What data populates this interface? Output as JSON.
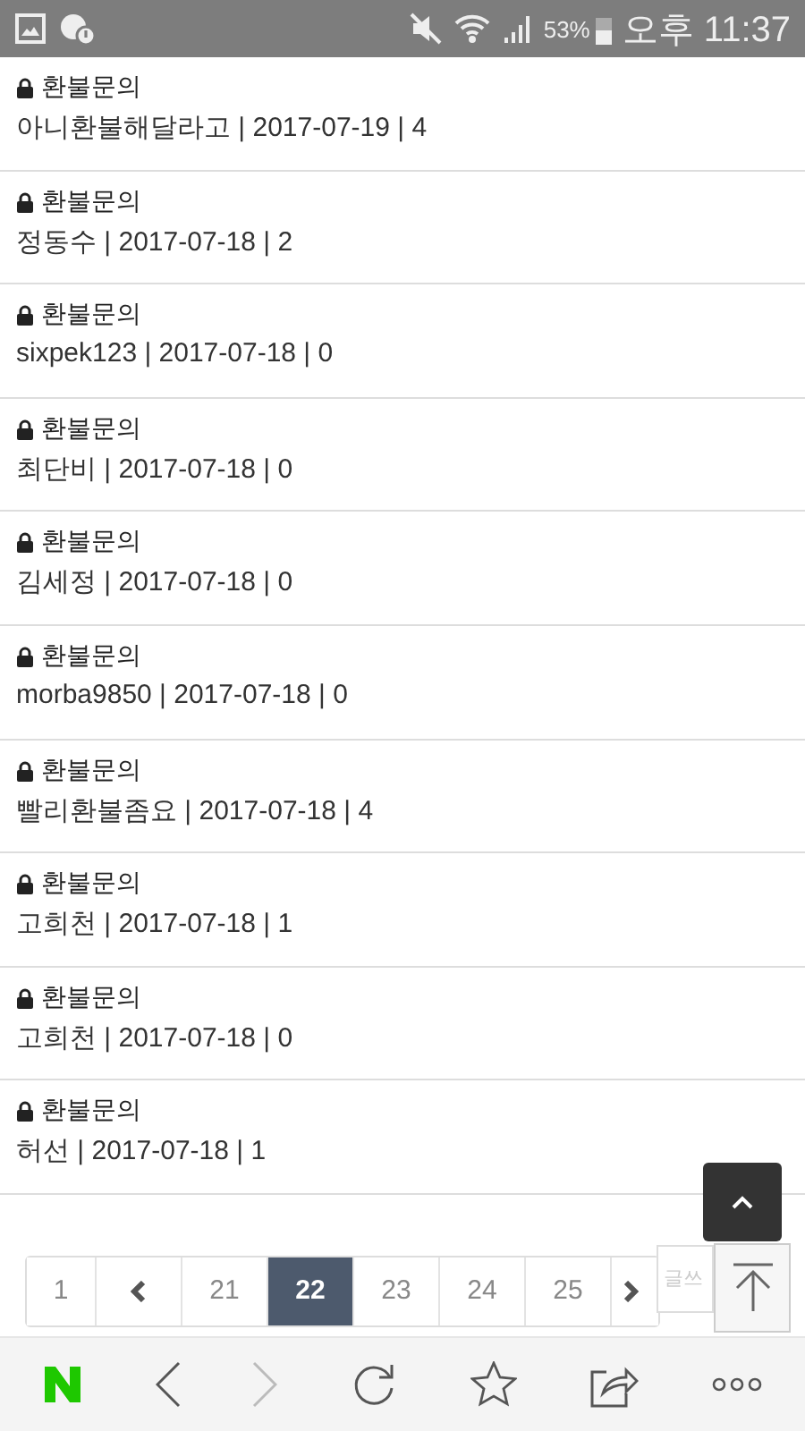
{
  "status_bar": {
    "battery": "53%",
    "time": "오후 11:37"
  },
  "posts": [
    {
      "title": "환불문의",
      "locked": true,
      "meta": "아니환불해달라고 | 2017-07-19 | 4"
    },
    {
      "title": "환불문의",
      "locked": true,
      "meta": "정동수 | 2017-07-18 | 2"
    },
    {
      "title": "환불문의",
      "locked": true,
      "meta": "sixpek123 | 2017-07-18 | 0"
    },
    {
      "title": "환불문의",
      "locked": true,
      "meta": "최단비 | 2017-07-18 | 0"
    },
    {
      "title": "환불문의",
      "locked": true,
      "meta": "김세정 | 2017-07-18 | 0"
    },
    {
      "title": "환불문의",
      "locked": true,
      "meta": "morba9850 | 2017-07-18 | 0"
    },
    {
      "title": "환불문의",
      "locked": true,
      "meta": "빨리환불좀요 | 2017-07-18 | 4"
    },
    {
      "title": "환불문의",
      "locked": true,
      "meta": "고희천 | 2017-07-18 | 1"
    },
    {
      "title": "환불문의",
      "locked": true,
      "meta": "고희천 | 2017-07-18 | 0"
    },
    {
      "title": "환불문의",
      "locked": true,
      "meta": "허선 | 2017-07-18 | 1"
    }
  ],
  "pagination": [
    {
      "kind": "page",
      "label": "1",
      "selected": false
    },
    {
      "kind": "prev"
    },
    {
      "kind": "page",
      "label": "21",
      "selected": false
    },
    {
      "kind": "page",
      "label": "22",
      "selected": true
    },
    {
      "kind": "page",
      "label": "23",
      "selected": false
    },
    {
      "kind": "page",
      "label": "24",
      "selected": false
    },
    {
      "kind": "page",
      "label": "25",
      "selected": false
    },
    {
      "kind": "next"
    }
  ],
  "write_button": {
    "label": "글쓰"
  }
}
